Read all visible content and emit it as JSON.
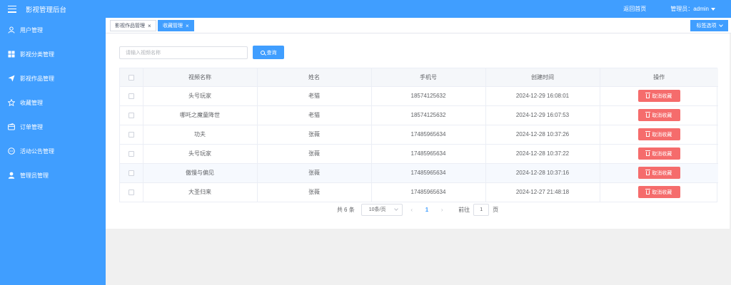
{
  "header": {
    "app_title": "影视管理后台",
    "back_home": "返回首页",
    "admin_label": "管理员：admin"
  },
  "sidebar": {
    "items": [
      {
        "label": "用户管理",
        "icon": "user-icon"
      },
      {
        "label": "影视分类管理",
        "icon": "grid-icon"
      },
      {
        "label": "影视作品管理",
        "icon": "paper-plane-icon"
      },
      {
        "label": "收藏管理",
        "icon": "star-icon"
      },
      {
        "label": "订单管理",
        "icon": "wallet-icon"
      },
      {
        "label": "活动公告管理",
        "icon": "chat-icon"
      },
      {
        "label": "管理员管理",
        "icon": "admin-user-icon"
      }
    ]
  },
  "tabs": {
    "items": [
      {
        "label": "影视作品管理",
        "active": false
      },
      {
        "label": "收藏管理",
        "active": true
      }
    ],
    "options_label": "标签选项"
  },
  "search": {
    "placeholder": "请输入视频名称",
    "button_label": "查询"
  },
  "table": {
    "columns": [
      "视频名称",
      "姓名",
      "手机号",
      "创建时间",
      "操作"
    ],
    "action_label": "取消收藏",
    "rows": [
      {
        "video": "头号玩家",
        "name": "老猫",
        "phone": "18574125632",
        "created": "2024-12-29 16:08:01"
      },
      {
        "video": "哪吒之魔童降世",
        "name": "老猫",
        "phone": "18574125632",
        "created": "2024-12-29 16:07:53"
      },
      {
        "video": "功夫",
        "name": "张薇",
        "phone": "17485965634",
        "created": "2024-12-28 10:37:26"
      },
      {
        "video": "头号玩家",
        "name": "张薇",
        "phone": "17485965634",
        "created": "2024-12-28 10:37:22"
      },
      {
        "video": "傲慢与偏见",
        "name": "张薇",
        "phone": "17485965634",
        "created": "2024-12-28 10:37:16"
      },
      {
        "video": "大圣归来",
        "name": "张薇",
        "phone": "17485965634",
        "created": "2024-12-27 21:48:18"
      }
    ]
  },
  "pagination": {
    "total_label": "共 6 条",
    "page_size_label": "10条/页",
    "current_page": "1",
    "goto_prefix": "前往",
    "goto_value": "1",
    "goto_suffix": "页"
  },
  "colors": {
    "primary": "#409eff",
    "danger": "#f56c6c"
  }
}
